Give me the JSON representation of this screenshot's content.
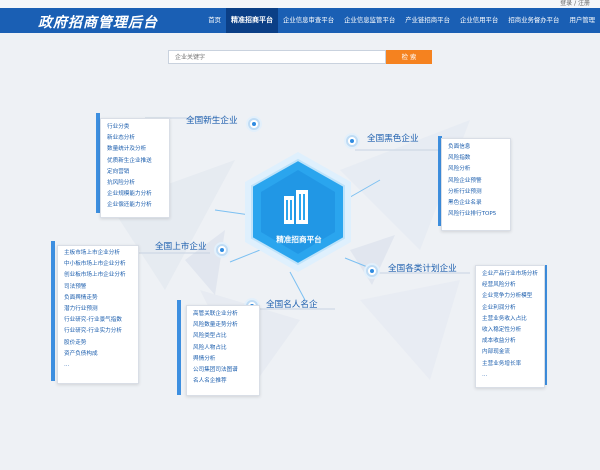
{
  "header": {
    "top_links": "登录 / 注册",
    "logo": "政府招商管理后台",
    "nav": [
      "首页",
      "精准招商平台",
      "企业信息审查平台",
      "企业信息监管平台",
      "产业链招商平台",
      "企业信用平台",
      "招商业务督办平台",
      "用户管理"
    ]
  },
  "search": {
    "placeholder": "企业关键字",
    "button": "检 索"
  },
  "center": {
    "label": "精准招商平台"
  },
  "categories": {
    "new": {
      "title": "全国新生企业",
      "items": [
        "行业分类",
        "新业态分析",
        "数量统计及分析",
        "优质新生企业推送",
        "定向营销",
        "抗风险分析",
        "企业规模能力分析",
        "企业偿还能力分析"
      ]
    },
    "black": {
      "title": "全国黑色企业",
      "items": [
        "负面信息",
        "风险指数",
        "风险分析",
        "风险企业预警",
        "分析行业预测",
        "黑色企业名录",
        "风险行业排行TOP5"
      ]
    },
    "listed": {
      "title": "全国上市企业",
      "items": [
        "主板市场上市企业分析",
        "中小板市场上市企业分析",
        "创业板市场上市企业分析",
        "司法预警",
        "负面舆情走势",
        "潜力行业预测",
        "行业研究-行业景气指数",
        "行业研究-行业实力分析",
        "股价走势",
        "资产负债构成",
        "..."
      ]
    },
    "plan": {
      "title": "全国各类计划企业",
      "items": [
        "企业产品行业市场分析",
        "经营风险分析",
        "企业竞争力分析模型",
        "企业利润分析",
        "主营业务收入占比",
        "收入稳定性分析",
        "成本收益分析",
        "内部现金流",
        "主营业务增长率",
        "..."
      ]
    },
    "famous": {
      "title": "全国名人名企",
      "items": [
        "高管关联企业分析",
        "风险数量走势分析",
        "风险类型占比",
        "风险人物占比",
        "舆情分析",
        "公司集团司法图谱",
        "名人名企推荐"
      ]
    }
  }
}
